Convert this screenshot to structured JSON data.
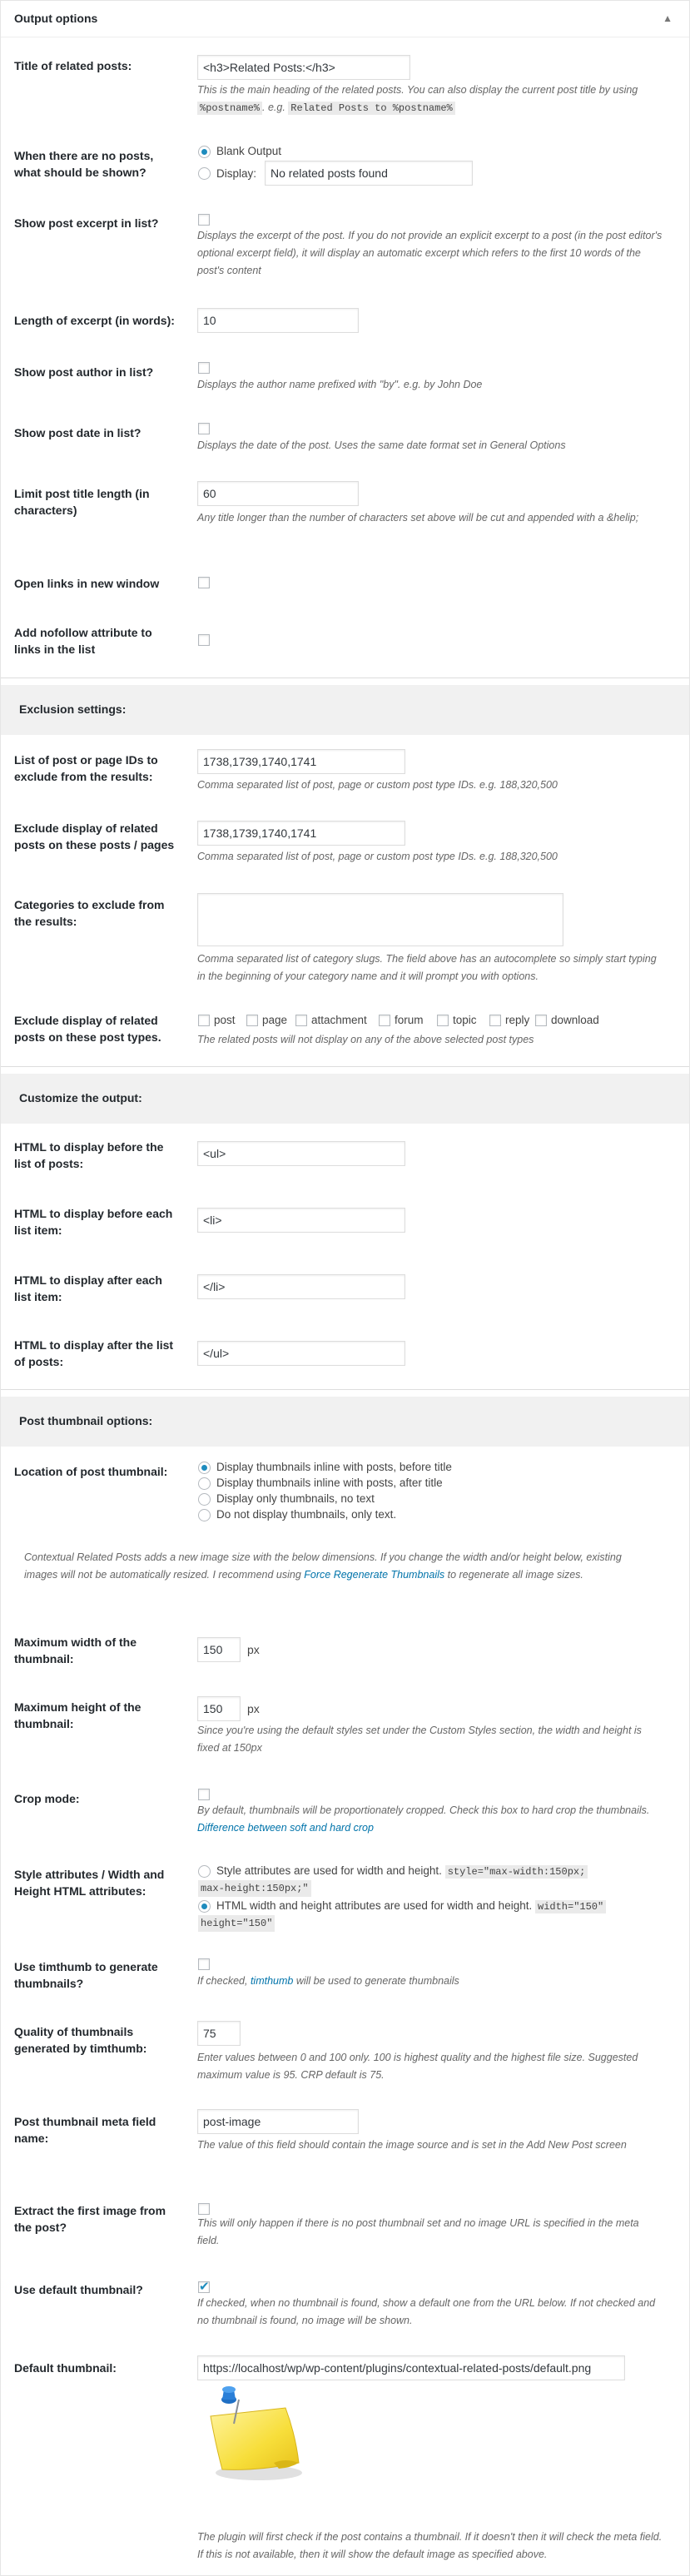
{
  "panel": {
    "title": "Output options",
    "collapse_icon": "caret-up-icon"
  },
  "title_related": {
    "label": "Title of related posts:",
    "value": "<h3>Related Posts:</h3>",
    "desc_a": "This is the main heading of the related posts. You can also display the current post title by using",
    "code1": "%postname%",
    "desc_b": ". e.g.",
    "code2": "Related Posts to %postname%"
  },
  "no_posts": {
    "label": "When there are no posts, what should be shown?",
    "opt_blank": "Blank Output",
    "opt_display": "Display:",
    "display_value": "No related posts found"
  },
  "show_excerpt": {
    "label": "Show post excerpt in list?",
    "desc": "Displays the excerpt of the post. If you do not provide an explicit excerpt to a post (in the post editor's optional excerpt field), it will display an automatic excerpt which refers to the first 10 words of the post's content"
  },
  "excerpt_length": {
    "label": "Length of excerpt (in words):",
    "value": "10"
  },
  "show_author": {
    "label": "Show post author in list?",
    "desc": "Displays the author name prefixed with \"by\". e.g. by John Doe"
  },
  "show_date": {
    "label": "Show post date in list?",
    "desc": "Displays the date of the post. Uses the same date format set in General Options"
  },
  "title_length": {
    "label": "Limit post title length (in characters)",
    "value": "60",
    "desc": "Any title longer than the number of characters set above will be cut and appended with a &helip;"
  },
  "open_new_window": {
    "label": "Open links in new window"
  },
  "nofollow": {
    "label": "Add nofollow attribute to links in the list"
  },
  "exclusion": {
    "title": "Exclusion settings:",
    "exclude_ids_label": "List of post or page IDs to exclude from the results:",
    "exclude_ids_value": "1738,1739,1740,1741",
    "exclude_ids_desc": "Comma separated list of post, page or custom post type IDs. e.g. 188,320,500",
    "exclude_on_label": "Exclude display of related posts on these posts / pages",
    "exclude_on_value": "1738,1739,1740,1741",
    "exclude_on_desc": "Comma separated list of post, page or custom post type IDs. e.g. 188,320,500",
    "categories_label": "Categories to exclude from the results:",
    "categories_value": "",
    "categories_desc": "Comma separated list of category slugs. The field above has an autocomplete so simply start typing in the beginning of your category name and it will prompt you with options.",
    "post_types_label": "Exclude display of related posts on these post types.",
    "post_types": [
      "post",
      "page",
      "attachment",
      "forum",
      "topic",
      "reply",
      "download"
    ],
    "post_types_desc": "The related posts will not display on any of the above selected post types"
  },
  "customize": {
    "title": "Customize the output:",
    "before_list_label": "HTML to display before the list of posts:",
    "before_list_value": "<ul>",
    "before_item_label": "HTML to display before each list item:",
    "before_item_value": "<li>",
    "after_item_label": "HTML to display after each list item:",
    "after_item_value": "</li>",
    "after_list_label": "HTML to display after the list of posts:",
    "after_list_value": "</ul>"
  },
  "thumbnail": {
    "title": "Post thumbnail options:",
    "location_label": "Location of post thumbnail:",
    "location_options": [
      "Display thumbnails inline with posts, before title",
      "Display thumbnails inline with posts, after title",
      "Display only thumbnails, no text",
      "Do not display thumbnails, only text."
    ],
    "size_note_a": "Contextual Related Posts adds a new image size with the below dimensions. If you change the width and/or height below, existing images will not be automatically resized. I recommend using",
    "size_note_link": "Force Regenerate Thumbnails",
    "size_note_b": "to regenerate all image sizes.",
    "max_width_label": "Maximum width of the thumbnail:",
    "max_width_value": "150",
    "max_height_label": "Maximum height of the thumbnail:",
    "max_height_value": "150",
    "px": "px",
    "height_desc": "Since you're using the default styles set under the Custom Styles section, the width and height is fixed at 150px",
    "crop_label": "Crop mode:",
    "crop_desc": "By default, thumbnails will be proportionately cropped. Check this box to hard crop the thumbnails.",
    "crop_link": "Difference between soft and hard crop",
    "style_label": "Style attributes / Width and Height HTML attributes:",
    "style_opt1": "Style attributes are used for width and height.",
    "style_opt1_code_a": "style=\"max-width:150px;",
    "style_opt1_code_b": "max-height:150px;\"",
    "style_opt2": "HTML width and height attributes are used for width and height.",
    "style_opt2_code_a": "width=\"150\"",
    "style_opt2_code_b": "height=\"150\"",
    "timthumb_label": "Use timthumb to generate thumbnails?",
    "timthumb_desc_a": "If checked,",
    "timthumb_link": "timthumb",
    "timthumb_desc_b": "will be used to generate thumbnails",
    "quality_label": "Quality of thumbnails generated by timthumb:",
    "quality_value": "75",
    "quality_desc": "Enter values between 0 and 100 only. 100 is highest quality and the highest file size. Suggested maximum value is 95. CRP default is 75.",
    "meta_label": "Post thumbnail meta field name:",
    "meta_value": "post-image",
    "meta_desc": "The value of this field should contain the image source and is set in the Add New Post screen",
    "extract_label": "Extract the first image from the post?",
    "extract_desc": "This will only happen if there is no post thumbnail set and no image URL is specified in the meta field.",
    "use_default_label": "Use default thumbnail?",
    "use_default_desc": "If checked, when no thumbnail is found, show a default one from the URL below. If not checked and no thumbnail is found, no image will be shown.",
    "default_label": "Default thumbnail:",
    "default_value": "https://localhost/wp/wp-content/plugins/contextual-related-posts/default.png",
    "default_image_icon": "pinned-note-icon",
    "final_desc": "The plugin will first check if the post contains a thumbnail. If it doesn't then it will check the meta field. If this is not available, then it will show the default image as specified above."
  }
}
